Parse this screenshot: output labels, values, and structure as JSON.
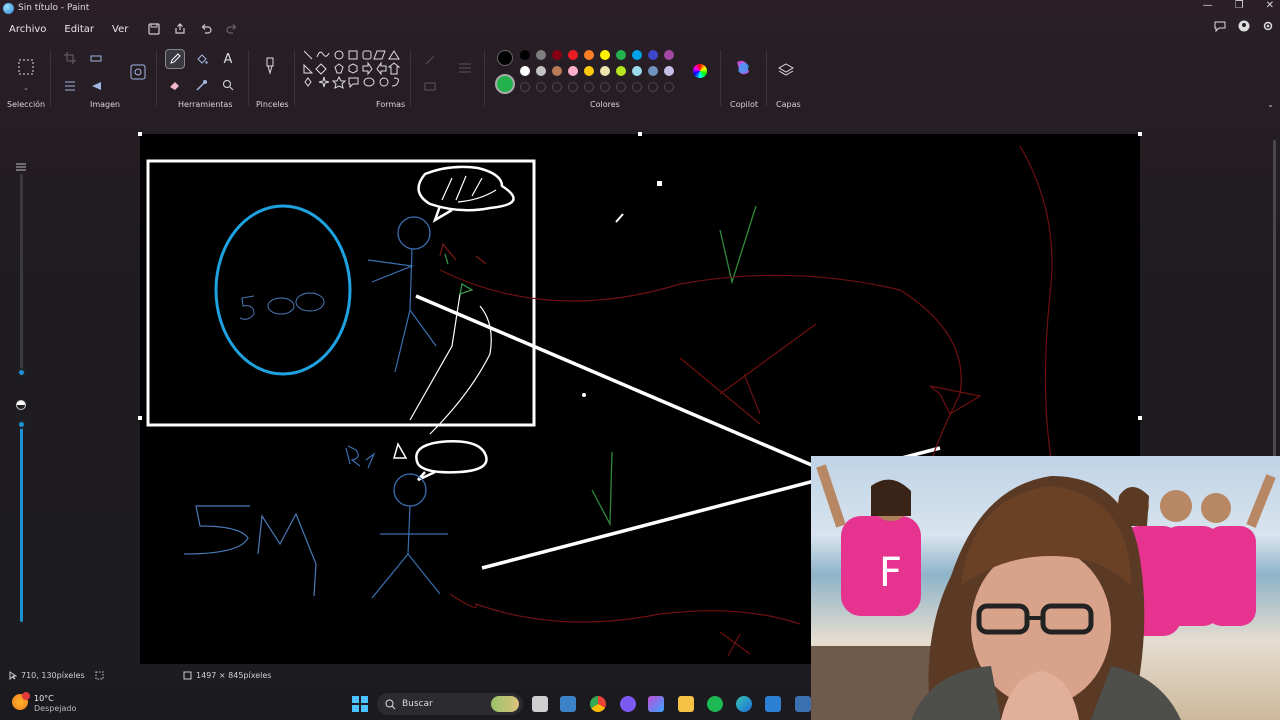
{
  "window": {
    "title": "Sin título - Paint",
    "controls": [
      "—",
      "❐",
      "✕"
    ]
  },
  "menu": {
    "items": [
      "Archivo",
      "Editar",
      "Ver"
    ]
  },
  "ribbon": {
    "groups": {
      "selection": "Selección",
      "image": "Imagen",
      "tools": "Herramientas",
      "brushes": "Pinceles",
      "shapes": "Formas",
      "colors": "Colores",
      "copilot": "Copilot",
      "layers": "Capas"
    },
    "palette_top": [
      "#000000",
      "#7f7f7f",
      "#880015",
      "#ed1c24",
      "#ff7f27",
      "#fff200",
      "#22b14c",
      "#00a2e8",
      "#3f48cc",
      "#a349a4"
    ],
    "palette_bottom": [
      "#ffffff",
      "#c3c3c3",
      "#b97a57",
      "#ffaec9",
      "#ffc90e",
      "#efe4b0",
      "#b5e61d",
      "#99d9ea",
      "#7092be",
      "#c8bfe7"
    ],
    "primary_color": "#000000",
    "secondary_color": "#22b14c"
  },
  "status": {
    "cursor": "710, 130píxeles",
    "canvas_size": "1497 × 845píxeles"
  },
  "taskbar": {
    "weather_temp": "10°C",
    "weather_desc": "Despejado",
    "search_placeholder": "Buscar"
  },
  "webcam": {
    "shirt_text": "F"
  }
}
